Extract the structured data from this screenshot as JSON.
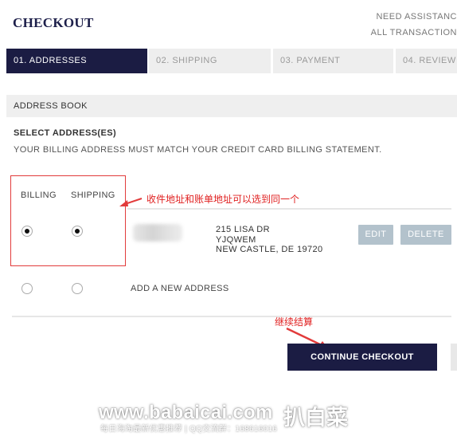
{
  "header": {
    "logo": "CHECKOUT",
    "links": [
      "NEED ASSISTANC",
      "ALL TRANSACTION"
    ]
  },
  "steps": [
    {
      "label": "01. ADDRESSES",
      "active": true
    },
    {
      "label": "02. SHIPPING",
      "active": false
    },
    {
      "label": "03. PAYMENT",
      "active": false
    },
    {
      "label": "04. REVIEW",
      "active": false
    }
  ],
  "address_book": {
    "title": "ADDRESS BOOK",
    "select_title": "SELECT ADDRESS(ES)",
    "note": "YOUR BILLING ADDRESS MUST MATCH YOUR CREDIT CARD BILLING STATEMENT.",
    "col_billing": "BILLING",
    "col_shipping": "SHIPPING",
    "saved_address": {
      "line1": "215 LISA DR",
      "line2": "YJQWEM",
      "line3": "NEW CASTLE, DE 19720",
      "billing_selected": true,
      "shipping_selected": true
    },
    "edit_label": "EDIT",
    "delete_label": "DELETE",
    "add_new_label": "ADD A NEW ADDRESS"
  },
  "continue_label": "CONTINUE CHECKOUT",
  "annotations": {
    "note1": "收件地址和账单地址可以选到同一个",
    "note2": "继续结算"
  },
  "watermark": {
    "site": "www.babaicai.com",
    "brand": "扒白菜",
    "sub": "每日海淘最新优惠推荐 | QQ交流群：168616016"
  },
  "colors": {
    "navy": "#1b1c43",
    "annotation_red": "#e23b3b",
    "button_gray": "#b3c2cc"
  }
}
